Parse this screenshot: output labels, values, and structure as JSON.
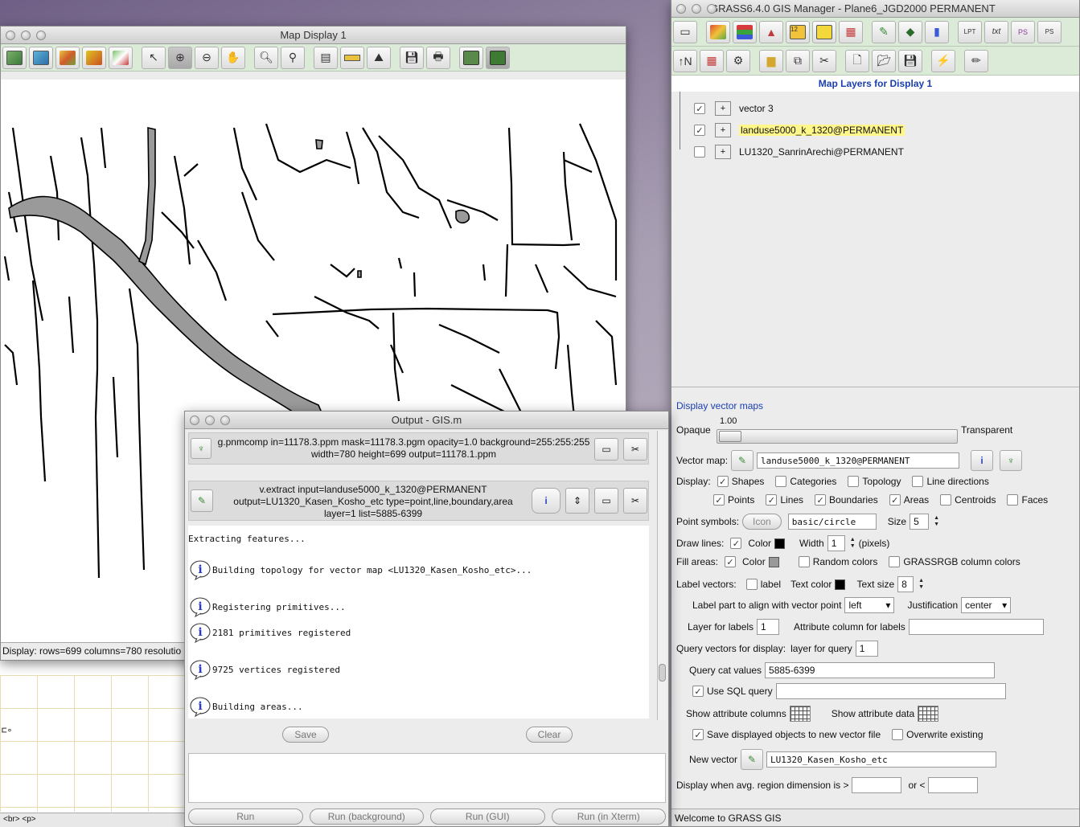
{
  "map_display": {
    "title": "Map Display 1",
    "status": "Display: rows=699  columns=780  resolutio"
  },
  "behind_window": {
    "symbol": "⊏∘",
    "status": "<br> <p>"
  },
  "manager": {
    "title": "GRASS6.4.0 GIS Manager - Plane6_JGD2000 PERMANENT",
    "layers_title": "Map Layers for Display 1",
    "layers": [
      {
        "name": "vector 3",
        "checked": true,
        "selected": false
      },
      {
        "name": "landuse5000_k_1320@PERMANENT",
        "checked": true,
        "selected": true
      },
      {
        "name": "LU1320_SanrinArechi@PERMANENT",
        "checked": false,
        "selected": false
      }
    ],
    "panel_title": "Display vector maps",
    "opaque_label": "Opaque",
    "opacity_value": "1.00",
    "transparent_label": "Transparent",
    "vector_map_label": "Vector map:",
    "vector_map_value": "landuse5000_k_1320@PERMANENT",
    "display_label": "Display:",
    "display_opts": {
      "shapes": "Shapes",
      "categories": "Categories",
      "topology": "Topology",
      "line_directions": "Line directions"
    },
    "type_opts": {
      "points": "Points",
      "lines": "Lines",
      "boundaries": "Boundaries",
      "areas": "Areas",
      "centroids": "Centroids",
      "faces": "Faces"
    },
    "point_symbols_label": "Point symbols:",
    "icon_button": "Icon",
    "symbol_value": "basic/circle",
    "size_label": "Size",
    "size_value": "5",
    "draw_lines_label": "Draw lines:",
    "color_label": "Color",
    "width_label": "Width",
    "width_value": "1",
    "pixels_label": "(pixels)",
    "fill_areas_label": "Fill areas:",
    "random_colors": "Random colors",
    "grassrgb": "GRASSRGB column colors",
    "label_vectors": "Label vectors:",
    "label_opt": "label",
    "text_color": "Text color",
    "text_size": "Text size",
    "text_size_value": "8",
    "label_part": "Label part to align with vector point",
    "label_part_value": "left",
    "justification": "Justification",
    "justification_value": "center",
    "layer_for_labels": "Layer for labels",
    "layer_for_labels_value": "1",
    "attr_col": "Attribute column for labels",
    "query_display": "Query vectors for display:",
    "layer_for_query": "layer for query",
    "layer_for_query_value": "1",
    "query_cat": "Query cat values",
    "query_cat_value": "5885-6399",
    "use_sql": "Use SQL query",
    "show_attr_cols": "Show attribute columns",
    "show_attr_data": "Show attribute data",
    "save_displayed": "Save displayed objects to new vector file",
    "overwrite": "Overwrite existing",
    "new_vector": "New vector",
    "new_vector_value": "LU1320_Kasen_Kosho_etc",
    "display_when": "Display when avg. region dimension is >",
    "or_less": "or <",
    "status": "Welcome to GRASS GIS"
  },
  "output": {
    "title": "Output - GIS.m",
    "cmd1_line1": "g.pnmcomp in=11178.3.ppm mask=11178.3.pgm opacity=1.0 background=255:255:255",
    "cmd1_line2": "width=780 height=699 output=11178.1.ppm",
    "cmd2_line1": "v.extract input=landuse5000_k_1320@PERMANENT",
    "cmd2_line2": "output=LU1320_Kasen_Kosho_etc type=point,line,boundary,area",
    "cmd2_line3": "layer=1 list=5885-6399",
    "log": [
      {
        "text": "Extracting features...",
        "icon": false
      },
      {
        "text": "Building topology for vector map <LU1320_Kasen_Kosho_etc>...",
        "icon": true
      },
      {
        "text": "Registering primitives...",
        "icon": true
      },
      {
        "text": "2181 primitives registered",
        "icon": true
      },
      {
        "text": "9725 vertices registered",
        "icon": true
      },
      {
        "text": "Building areas...",
        "icon": true
      }
    ],
    "save_button": "Save",
    "clear_button": "Clear",
    "run_buttons": [
      "Run",
      "Run (background)",
      "Run (GUI)",
      "Run (in Xterm)"
    ]
  },
  "colors": {
    "toolbar_bg": "#dcebd8",
    "layer_title": "#1a3fb0",
    "selected_layer": "#fff78a"
  }
}
